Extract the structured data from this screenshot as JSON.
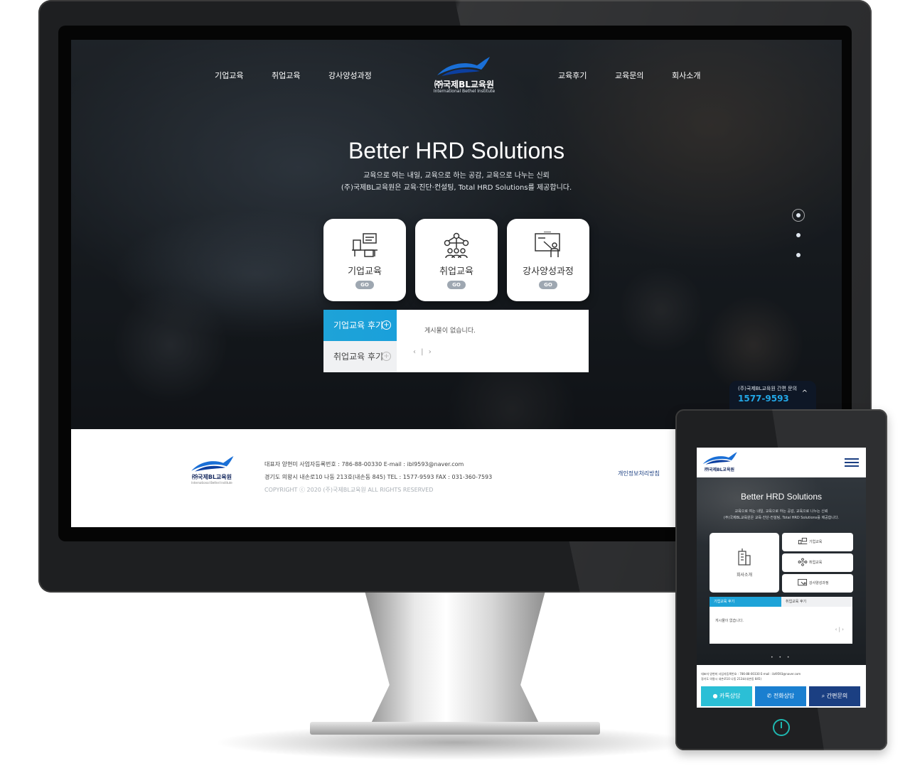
{
  "desktop": {
    "nav_left": [
      "기업교육",
      "취업교육",
      "강사양성과정"
    ],
    "nav_right": [
      "교육후기",
      "교육문의",
      "회사소개"
    ],
    "logo": {
      "title": "㈜국제BL교육원",
      "subtitle": "International Bethel Institute"
    },
    "hero": {
      "title": "Better HRD Solutions",
      "desc_line1": "교육으로 여는 내일, 교육으로 하는 공감, 교육으로 나누는 신뢰",
      "desc_line2": "(주)국제BL교육원은 교육·진단·컨설팅, Total HRD Solutions를 제공합니다."
    },
    "cards": [
      {
        "label": "기업교육",
        "go": "GO",
        "icon": "office-desk-icon"
      },
      {
        "label": "취업교육",
        "go": "GO",
        "icon": "people-network-icon"
      },
      {
        "label": "강사양성과정",
        "go": "GO",
        "icon": "lecturer-board-icon"
      }
    ],
    "reviews": {
      "tab_corporate": "기업교육 후기",
      "tab_employment": "취업교육 후기",
      "plus": "+",
      "empty": "게시물이 없습니다.",
      "pager": "‹ | ›"
    },
    "quick_contact": {
      "label": "(주)국제BL교육원 간편 문의",
      "phone": "1577-9593",
      "caret": "^"
    },
    "footer": {
      "line1": "대표자 양현미    사업자등록번호 : 786-88-00330    E-mail : ibl9593@naver.com",
      "line2": "경기도 의왕시 내손로10 나동 213호(내손동 845)    TEL : 1577-9593    FAX : 031-360-7593",
      "copyright": "COPYRIGHT ⓒ 2020 (주)국제BL교육원 ALL RIGHTS RESERVED",
      "privacy": "개인정보처리방침"
    }
  },
  "tablet": {
    "logo_title": "㈜국제BL교육원",
    "hero_title": "Better HRD Solutions",
    "desc_line1": "교육으로 여는 내일, 교육으로 하는 공감, 교육으로 나누는 신뢰",
    "desc_line2": "(주)국제BL교육원은 교육·진단·컨설팅, Total HRD Solutions를 제공합니다.",
    "big_card": "회사소개",
    "small_cards": [
      "기업교육",
      "취업교육",
      "강사양성과정"
    ],
    "reviews": {
      "tab_corporate": "기업교육 후기",
      "tab_employment": "취업교육 후기",
      "empty": "게시물이 없습니다.",
      "pager": "‹ | ›"
    },
    "dots": "• • •",
    "footer_line1": "대표자 양현미  사업자등록번호 : 786-88-00330  E-mail : ibl9593@naver.com",
    "footer_line2": "경기도 의왕시 내손로10 나동 213호(내손동 845)",
    "buttons": [
      {
        "label": "카톡상담",
        "color": "#2bbfd6"
      },
      {
        "label": "전화상담",
        "color": "#1a7fd0"
      },
      {
        "label": "간편문의",
        "color": "#1b3f82"
      }
    ]
  },
  "colors": {
    "accent": "#1ea3d8",
    "brand_navy": "#1b2e63",
    "phone_blue": "#22a7e6"
  }
}
